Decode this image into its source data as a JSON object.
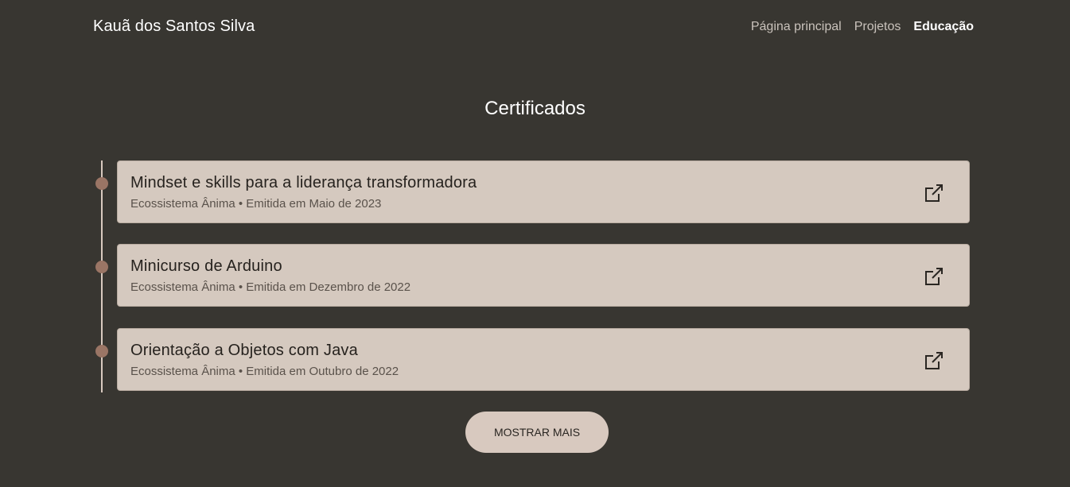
{
  "header": {
    "brand": "Kauã dos Santos Silva",
    "nav": [
      "Página principal",
      "Projetos",
      "Educação"
    ],
    "active": "Educação"
  },
  "section": {
    "title": "Certificados"
  },
  "certificates": [
    {
      "title": "Mindset e skills para a liderança transformadora",
      "subtitle": "Ecossistema Ânima • Emitida em Maio de 2023"
    },
    {
      "title": "Minicurso de Arduino",
      "subtitle": "Ecossistema Ânima • Emitida em Dezembro de 2022"
    },
    {
      "title": "Orientação a Objetos com Java",
      "subtitle": "Ecossistema Ânima • Emitida em Outubro de 2022"
    }
  ],
  "button": {
    "label": "MOSTRAR MAIS"
  },
  "colors": {
    "background": "#383631",
    "card": "#d5c9bf",
    "dot": "#9a7565",
    "line": "#d8c9bf",
    "nav_inactive": "#c9c2bb"
  },
  "icons": {
    "external": "external-link-icon"
  }
}
